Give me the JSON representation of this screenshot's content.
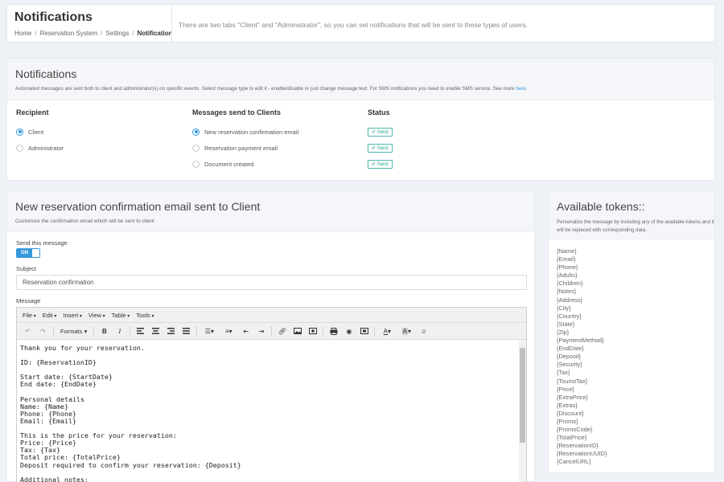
{
  "header": {
    "title": "Notifications",
    "breadcrumb": [
      "Home",
      "Reservation System",
      "Settings",
      "Notifications"
    ],
    "info": "There are two tabs \"Client\" and \"Administrator\", so you can set notifications that will be sent to these types of users."
  },
  "notifications": {
    "title": "Notifications",
    "description": "Automated messages are sent both to client and administrator(s) on specific events. Select message type to edit it - enable/disable or just change message text. For SMS notifications you need to enable SMS service. See more",
    "description_link": "here",
    "recipient": {
      "title": "Recipient",
      "options": [
        {
          "label": "Client",
          "selected": true
        },
        {
          "label": "Administrator",
          "selected": false
        }
      ]
    },
    "messages": {
      "title": "Messages send to Clients",
      "options": [
        {
          "label": "New reservation confirmation email",
          "selected": true
        },
        {
          "label": "Reservation payment email",
          "selected": false
        },
        {
          "label": "Document created",
          "selected": false
        }
      ]
    },
    "status": {
      "title": "Status",
      "badges": [
        "✔ Send",
        "✔ Send",
        "✔ Send"
      ]
    }
  },
  "editor": {
    "title": "New reservation confirmation email sent to Client",
    "description": "Customize the confirmation email which will be sent to client",
    "send_label": "Send this message",
    "toggle_label": "ON",
    "subject_label": "Subject",
    "subject_value": "Reservation confirmation",
    "message_label": "Message",
    "menubar": [
      "File",
      "Edit",
      "Insert",
      "View",
      "Table",
      "Tools"
    ],
    "formats_label": "Formats ▾",
    "body_lines": [
      "Thank you for your reservation.",
      "",
      "ID: {ReservationID}",
      "",
      "Start date: {StartDate}",
      "End date: {EndDate}",
      "",
      "Personal details",
      "Name: {Name}",
      "Phone: {Phone}",
      "Email: {Email}",
      "",
      "This is the price for your reservation:",
      "Price: {Price}",
      "Tax: {Tax}",
      "Total price: {TotalPrice}",
      "Deposit required to confirm your reservation: {Deposit}",
      "",
      "Additional notes:"
    ]
  },
  "tokens": {
    "title": "Available tokens::",
    "description": "Personalize the message by including any of the available tokens and it will be replaced with corresponding data.",
    "items": [
      "{Name}",
      "{Email}",
      "{Phone}",
      "{Adults}",
      "{Children}",
      "{Notes}",
      "{Address}",
      "{City}",
      "{Country}",
      "{State}",
      "{Zip}",
      "{PaymentMethod}",
      "{EndDate}",
      "{Deposit}",
      "{Security}",
      "{Tax}",
      "{TouristTax}",
      "{Price}",
      "{ExtraPrice}",
      "{Extras}",
      "{Discount}",
      "{Promo}",
      "{PromoCode}",
      "{TotalPrice}",
      "{ReservationID}",
      "{ReservationUUID}",
      "{CancelURL}"
    ]
  },
  "colors": {
    "accent": "#3598dc",
    "send_badge": "#26a69a"
  }
}
